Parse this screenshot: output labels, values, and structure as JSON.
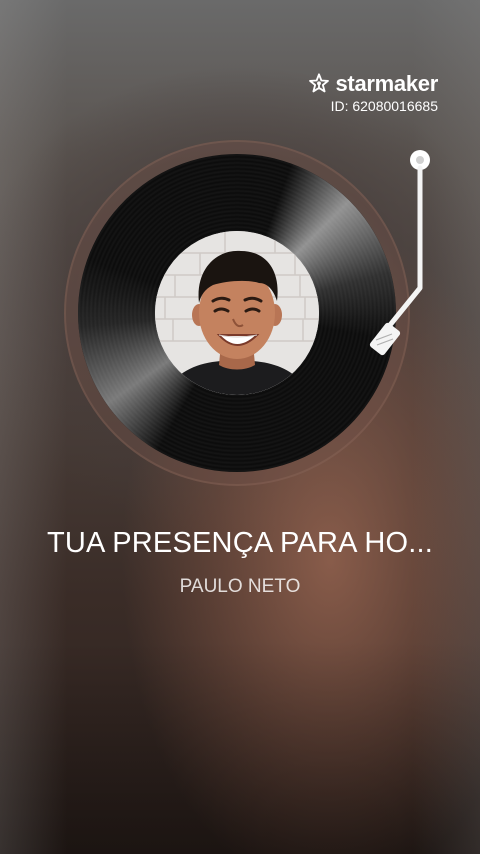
{
  "brand": {
    "name": "starmaker",
    "id_text": "ID: 62080016685",
    "icon": "starmaker-logo-icon"
  },
  "player": {
    "disc_icon": "vinyl-record-icon",
    "tonearm_icon": "tonearm-icon",
    "cover_image": "singer-portrait"
  },
  "song": {
    "title": "TUA PRESENÇA PARA HO...",
    "artist": "PAULO NETO"
  }
}
